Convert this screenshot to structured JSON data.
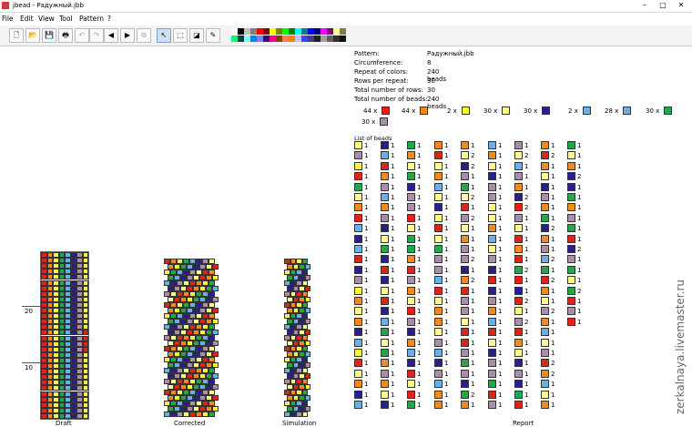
{
  "window": {
    "title": "jbead - Радужный.jbb",
    "min": "–",
    "max": "□",
    "close": "✕"
  },
  "menu": [
    "File",
    "Edit",
    "View",
    "Tool",
    "Pattern",
    "?"
  ],
  "toolbar": {
    "buttons": [
      {
        "name": "new-file-icon",
        "glyph": "🗋",
        "disabled": false
      },
      {
        "name": "open-file-icon",
        "glyph": "📂",
        "disabled": false
      },
      {
        "name": "save-file-icon",
        "glyph": "💾",
        "disabled": false
      },
      {
        "name": "print-icon",
        "glyph": "🖶",
        "disabled": false
      },
      {
        "name": "undo-icon",
        "glyph": "↶",
        "disabled": true
      },
      {
        "name": "redo-icon",
        "glyph": "↷",
        "disabled": true
      },
      {
        "name": "scroll-left-icon",
        "glyph": "◀",
        "disabled": false
      },
      {
        "name": "scroll-right-icon",
        "glyph": "▶",
        "disabled": false
      },
      {
        "name": "copy-icon",
        "glyph": "⧉",
        "disabled": true
      },
      {
        "name": "pointer-tool-icon",
        "glyph": "↖",
        "disabled": false,
        "active": true
      },
      {
        "name": "select-tool-icon",
        "glyph": "⬚",
        "disabled": false
      },
      {
        "name": "fill-tool-icon",
        "glyph": "◪",
        "disabled": false
      },
      {
        "name": "pipette-tool-icon",
        "glyph": "✎",
        "disabled": false
      }
    ]
  },
  "palette": {
    "row1": [
      "#ffffff",
      "#000000",
      "#c0c0c0",
      "#808080",
      "#ff0000",
      "#800000",
      "#ffff00",
      "#808000",
      "#00ff00",
      "#008000",
      "#00ffff",
      "#008080",
      "#0000ff",
      "#000080",
      "#ff00ff",
      "#800080",
      "#ffff80",
      "#808040"
    ],
    "row2": [
      "#00ff80",
      "#004040",
      "#80ffff",
      "#0080ff",
      "#8080ff",
      "#400080",
      "#ff0080",
      "#804000",
      "#ff8040",
      "#ff8000",
      "#c0c0ff",
      "#4040ff",
      "#404080",
      "#202020",
      "#a0a0a0",
      "#606060",
      "#303030",
      "#101010"
    ]
  },
  "labels": {
    "draft": "Draft",
    "corrected": "Corrected",
    "simulation": "Simulation",
    "report": "Report",
    "scale_20": "20",
    "scale_10": "10"
  },
  "colors": {
    "red": "#e32119",
    "orange": "#f28a1e",
    "yellow": "#f9f541",
    "lightyellow": "#fdfc8c",
    "navy": "#2a1e8c",
    "blue": "#6ab0e8",
    "green": "#20a84a",
    "mauve": "#a88ea8"
  },
  "draft_columns": [
    "red",
    "orange",
    "yellow",
    "green",
    "blue",
    "navy",
    "mauve",
    "yellow"
  ],
  "report": {
    "rows": [
      {
        "label": "Pattern:",
        "value": "Радужный.jbb"
      },
      {
        "label": "Circumference:",
        "value": "8"
      },
      {
        "label": "Repeat of colors:",
        "value": "240 beads"
      },
      {
        "label": "Rows per repeat:",
        "value": "30"
      },
      {
        "label": "Total number of rows:",
        "value": "30"
      },
      {
        "label": "Total number of beads:",
        "value": "240 beads"
      }
    ],
    "counts": [
      {
        "text": "44 x",
        "color": "red"
      },
      {
        "text": "44 x",
        "color": "orange"
      },
      {
        "text": "2 x",
        "color": "yellow"
      },
      {
        "text": "30 x",
        "color": "lightyellow"
      },
      {
        "text": "30 x",
        "color": "navy"
      },
      {
        "text": "2 x",
        "color": "blue"
      },
      {
        "text": "28 x",
        "color": "blue"
      },
      {
        "text": "30 x",
        "color": "green"
      },
      {
        "text": "30 x",
        "color": "mauve"
      }
    ],
    "list_title": "List of beads"
  },
  "watermark": "zerkalnaya.livemaster.ru"
}
